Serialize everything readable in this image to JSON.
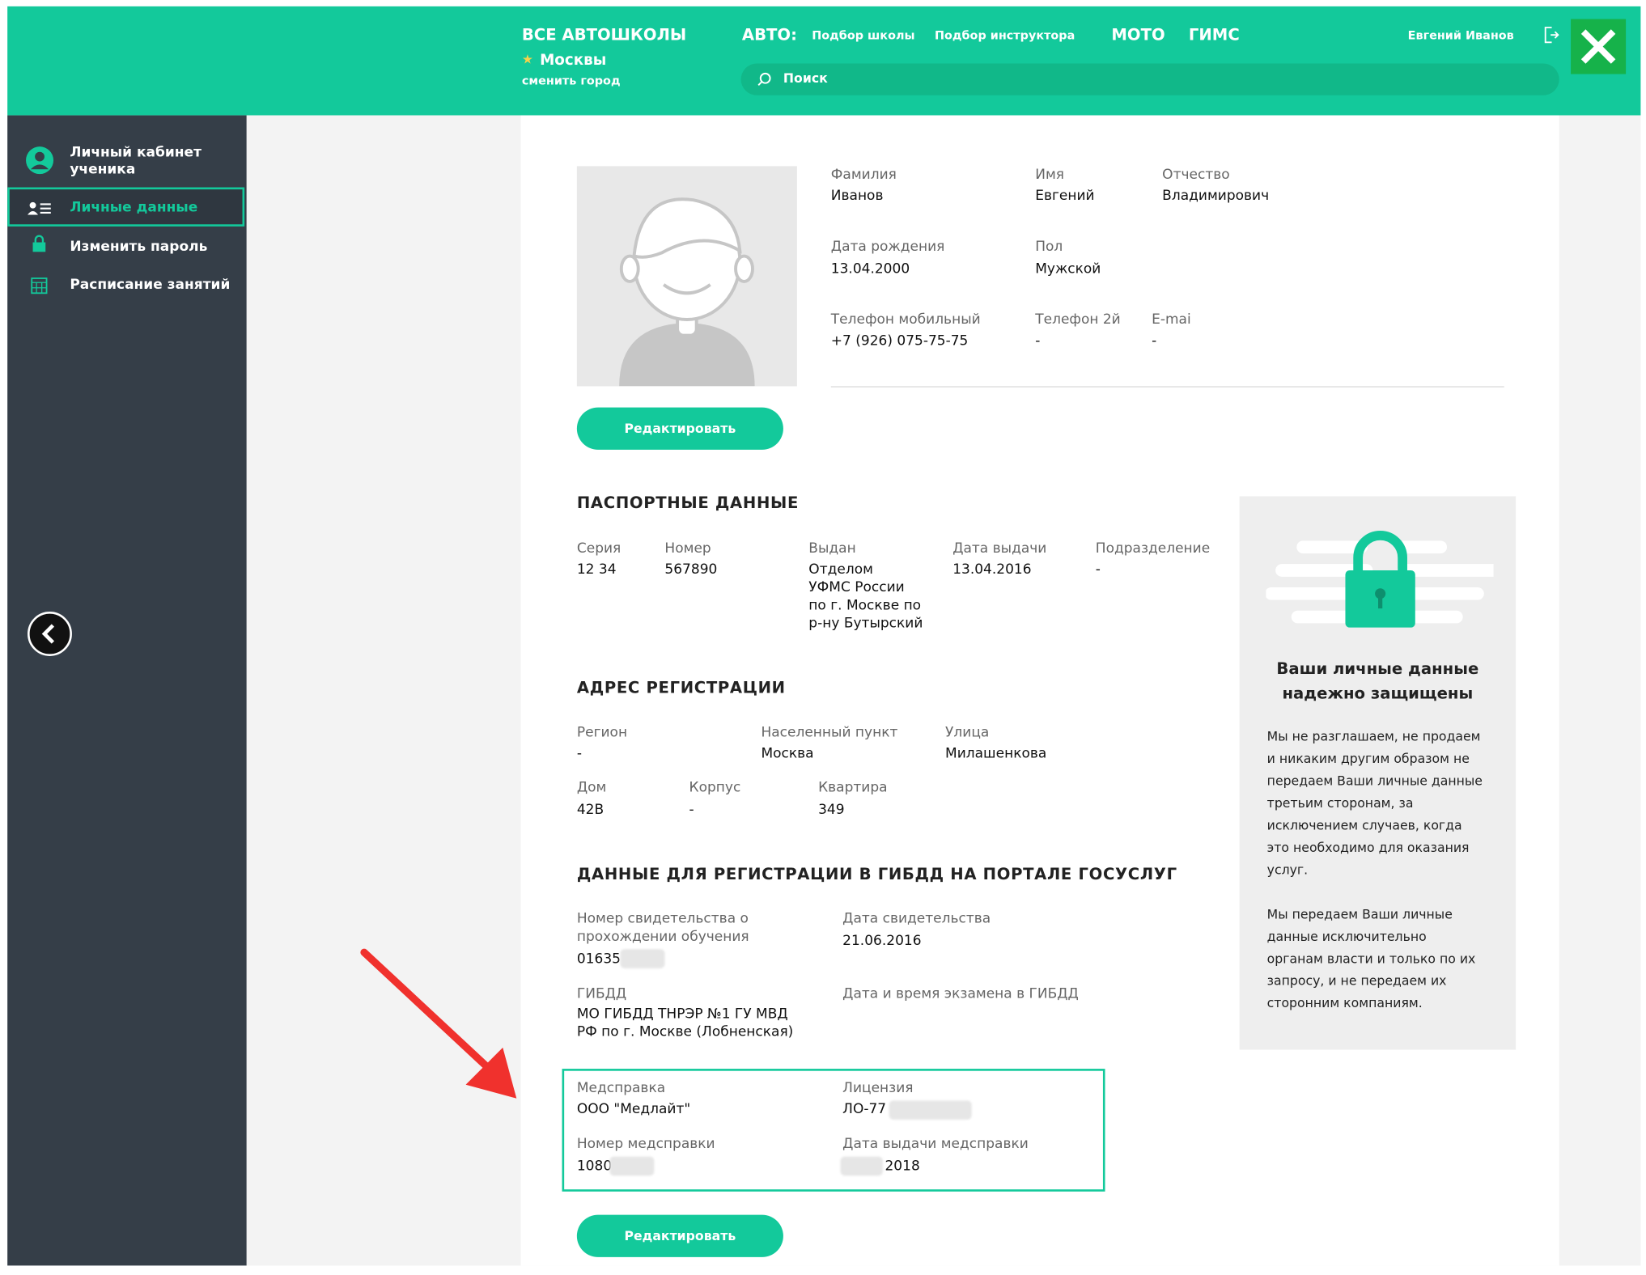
{
  "header": {
    "all_schools": "ВСЕ АВТОШКОЛЫ",
    "city": "Москвы",
    "change_city": "сменить город",
    "auto_label": "АВТО:",
    "nav_school": "Подбор школы",
    "nav_instructor": "Подбор инструктора",
    "moto": "МОТО",
    "gims": "ГИМС",
    "user_name": "Евгений Иванов",
    "search_placeholder": "Поиск"
  },
  "sidebar": {
    "title_line1": "Личный кабинет",
    "title_line2": "ученика",
    "items": [
      {
        "label": "Личные данные",
        "active": true
      },
      {
        "label": "Изменить пароль",
        "active": false
      },
      {
        "label": "Расписание занятий",
        "active": false
      }
    ]
  },
  "profile": {
    "surname_label": "Фамилия",
    "surname": "Иванов",
    "name_label": "Имя",
    "name": "Евгений",
    "patronymic_label": "Отчество",
    "patronymic": "Владимирович",
    "birth_label": "Дата рождения",
    "birth": "13.04.2000",
    "gender_label": "Пол",
    "gender": "Мужской",
    "mobile_label": "Телефон мобильный",
    "mobile": "+7 (926) 075-75-75",
    "phone2_label": "Телефон 2й",
    "phone2": "-",
    "email_label": "E-mai",
    "email": "-",
    "edit_label": "Редактировать"
  },
  "passport": {
    "heading": "ПАСПОРТНЫЕ ДАННЫЕ",
    "series_label": "Серия",
    "series": "12 34",
    "number_label": "Номер",
    "number": "567890",
    "issued_label": "Выдан",
    "issued_lines": [
      "Отделом",
      "УФМС России",
      "по г. Москве по",
      "р-ну Бутырский"
    ],
    "date_label": "Дата выдачи",
    "date": "13.04.2016",
    "dept_label": "Подразделение",
    "dept": "-"
  },
  "address": {
    "heading": "АДРЕС РЕГИСТРАЦИИ",
    "region_label": "Регион",
    "region": "-",
    "locality_label": "Населенный пункт",
    "locality": "Москва",
    "street_label": "Улица",
    "street": "Милашенкова",
    "house_label": "Дом",
    "house": "42В",
    "building_label": "Корпус",
    "building": "-",
    "flat_label": "Квартира",
    "flat": "349"
  },
  "gibdd": {
    "heading": "ДАННЫЕ ДЛЯ РЕГИСТРАЦИИ В ГИБДД НА ПОРТАЛЕ ГОСУСЛУГ",
    "cert_label_1": "Номер свидетельства о",
    "cert_label_2": "прохождении обучения",
    "cert": "01635",
    "cert_date_label": "Дата свидетельства",
    "cert_date": "21.06.2016",
    "gibdd_label": "ГИБДД",
    "gibdd_line1": "МО ГИБДД ТНРЭР №1 ГУ МВД",
    "gibdd_line2": "РФ по г. Москве (Лобненская)",
    "exam_label": "Дата и время экзамена в ГИБДД",
    "med_label": "Медсправка",
    "med": "ООО \"Медлайт\"",
    "license_label": "Лицензия",
    "license": "ЛО-77",
    "med_num_label": "Номер медсправки",
    "med_num": "1080",
    "med_date_label": "Дата выдачи медсправки",
    "med_date": "2018",
    "edit_label": "Редактировать"
  },
  "privacy": {
    "title_line1": "Ваши личные данные",
    "title_line2": "надежно защищены",
    "p1": [
      "Мы не разглашаем, не продаем",
      "и никаким другим образом не",
      "передаем Ваши личные данные",
      "третьим сторонам, за",
      "исключением случаев, когда",
      "это необходимо для оказания",
      "услуг."
    ],
    "p2": [
      "Мы передаем Ваши личные",
      "данные исключительно",
      "органам власти и только по их",
      "запросу, и не передаем их",
      "сторонним компаниям."
    ]
  },
  "colors": {
    "accent": "#13c99b",
    "sidebar": "#353e48",
    "close": "#16b24a",
    "arrow": "#f0312d"
  }
}
